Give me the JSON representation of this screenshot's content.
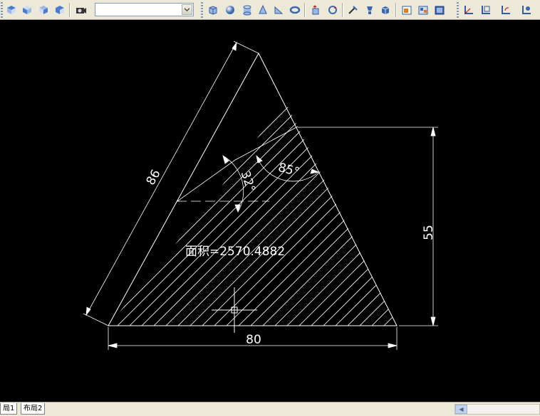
{
  "toolbar": {
    "icons": [
      "view-top-icon",
      "view-front-icon",
      "view-side-icon",
      "view-iso-icon",
      "camera-icon",
      "box-icon",
      "sphere-icon",
      "cylinder-icon",
      "cone-icon",
      "wedge-icon",
      "torus-icon",
      "extrude-icon",
      "revolve-icon",
      "section-icon",
      "slice-icon",
      "solid-icon",
      "render-icon",
      "scene-icon",
      "materials-icon",
      "ucs-icon",
      "ucs-face-icon",
      "ucs-prev-icon",
      "ucs-world-icon"
    ],
    "layer_combo_value": ""
  },
  "drawing": {
    "dim_slant_length": "86",
    "dim_height": "55",
    "dim_base": "80",
    "angle_1": "32°",
    "angle_2": "85°",
    "area_label": "面积=2570.4882"
  },
  "layout_tabs": [
    "局1",
    "布局2"
  ],
  "colors": {
    "background": "#000000",
    "lines": "#ffffff",
    "toolbar": "#ece9d8"
  }
}
